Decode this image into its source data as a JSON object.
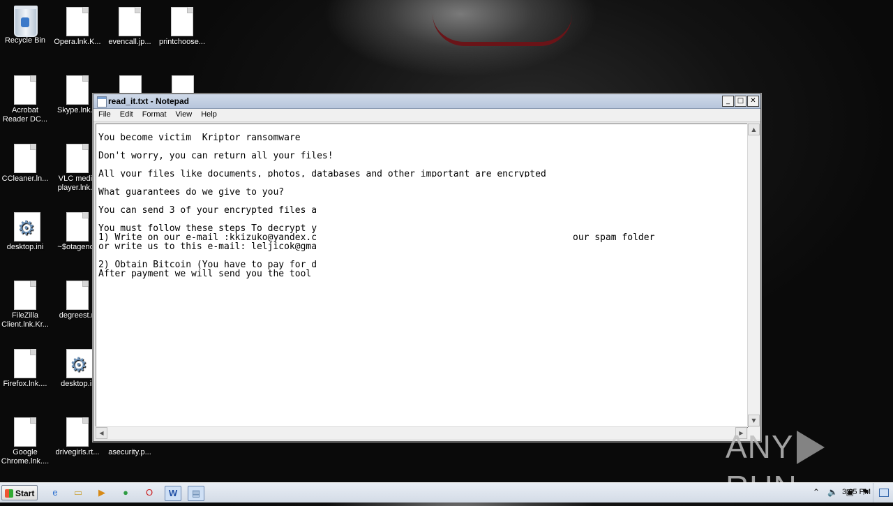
{
  "desktop": {
    "icons": [
      {
        "label_l1": "Recycle Bin",
        "label_l2": "",
        "type": "bin"
      },
      {
        "label_l1": "Opera.lnk.K...",
        "label_l2": "",
        "type": "doc"
      },
      {
        "label_l1": "evencall.jp...",
        "label_l2": "",
        "type": "doc"
      },
      {
        "label_l1": "printchoose...",
        "label_l2": "",
        "type": "doc"
      },
      {
        "label_l1": "Acrobat",
        "label_l2": "Reader DC...",
        "type": "doc"
      },
      {
        "label_l1": "Skype.lnk.K",
        "label_l2": "",
        "type": "doc"
      },
      {
        "label_l1": "CCleaner.ln...",
        "label_l2": "",
        "type": "doc"
      },
      {
        "label_l1": "VLC media",
        "label_l2": "player.lnk.K",
        "type": "doc"
      },
      {
        "label_l1": "desktop.ini",
        "label_l2": "",
        "type": "gear"
      },
      {
        "label_l1": "~$otagency",
        "label_l2": "",
        "type": "doc"
      },
      {
        "label_l1": "FileZilla",
        "label_l2": "Client.lnk.Kr...",
        "type": "doc"
      },
      {
        "label_l1": "degreest.rt",
        "label_l2": "",
        "type": "doc"
      },
      {
        "label_l1": "Firefox.lnk....",
        "label_l2": "",
        "type": "doc"
      },
      {
        "label_l1": "desktop.ir",
        "label_l2": "",
        "type": "gear"
      },
      {
        "label_l1": "Google",
        "label_l2": "Chrome.lnk....",
        "type": "doc"
      },
      {
        "label_l1": "drivegirls.rt...",
        "label_l2": "",
        "type": "doc"
      },
      {
        "label_l1": "asecurity.p...",
        "label_l2": "",
        "type": "doc"
      }
    ]
  },
  "notepad": {
    "title": "read_it.txt - Notepad",
    "menu": [
      "File",
      "Edit",
      "Format",
      "View",
      "Help"
    ],
    "controls": {
      "minimize": "_",
      "maximize": "□",
      "close": "✕"
    },
    "lines": [
      "You become victim  Kriptor ransomware",
      "Don't worry, you can return all your files!",
      "All your files like documents, photos, databases and other important are encrypted",
      "What guarantees do we give to you?",
      "You can send 3 of your encrypted files a",
      "You must follow these steps To decrypt y",
      "1) Write on our e-mail :kkizuko@yandex.c",
      "our spam folder",
      "or write us to this e-mail: leljicok@gma",
      "2) Obtain Bitcoin (You have to pay for d",
      "After payment we will send you the tool"
    ]
  },
  "watermark": {
    "left": "ANY",
    "right": "RUN"
  },
  "taskbar": {
    "start_label": "Start",
    "clock": "3:05 PM",
    "tray_icons": [
      "chevron-up-icon",
      "speaker-icon",
      "network-icon",
      "flag-icon"
    ]
  }
}
